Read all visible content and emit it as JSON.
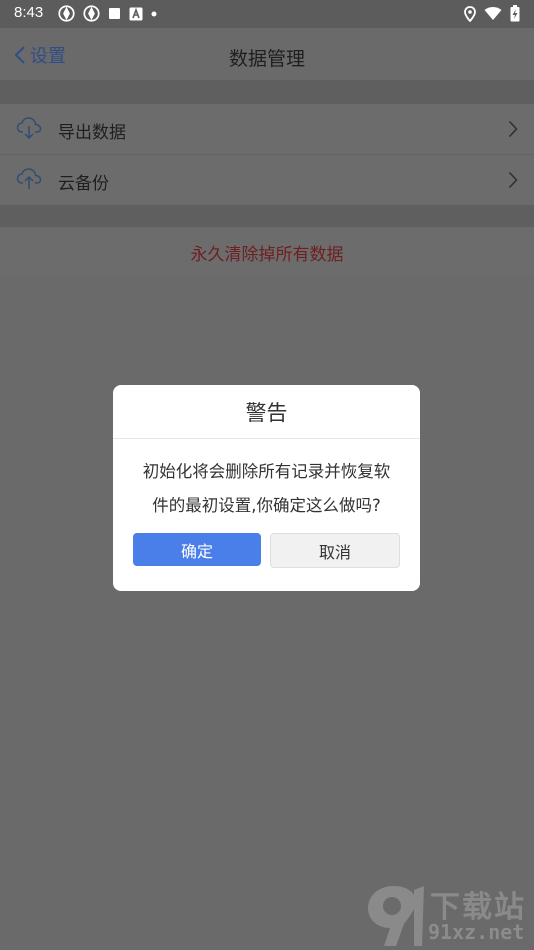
{
  "status_bar": {
    "time": "8:43",
    "left_icons": [
      "aperture-icon",
      "aperture-icon",
      "square-icon",
      "text-a-icon",
      "dot-icon"
    ],
    "right_icons": [
      "location-icon",
      "wifi-icon",
      "battery-charging-icon"
    ]
  },
  "nav": {
    "back_label": "设置",
    "title": "数据管理"
  },
  "list": {
    "items": [
      {
        "label": "导出数据",
        "icon": "cloud-download-icon"
      },
      {
        "label": "云备份",
        "icon": "cloud-upload-icon"
      }
    ]
  },
  "danger": {
    "label": "永久清除掉所有数据",
    "color": "#6e1f22"
  },
  "dialog": {
    "title": "警告",
    "message_line1": "初始化将会删除所有记录并恢复软",
    "message_line2": "件的最初设置,你确定这么做吗?",
    "confirm_label": "确定",
    "cancel_label": "取消",
    "confirm_color": "#4a7ee8"
  },
  "watermark": {
    "brand_cn": "下载站",
    "url": "91xz.net"
  }
}
